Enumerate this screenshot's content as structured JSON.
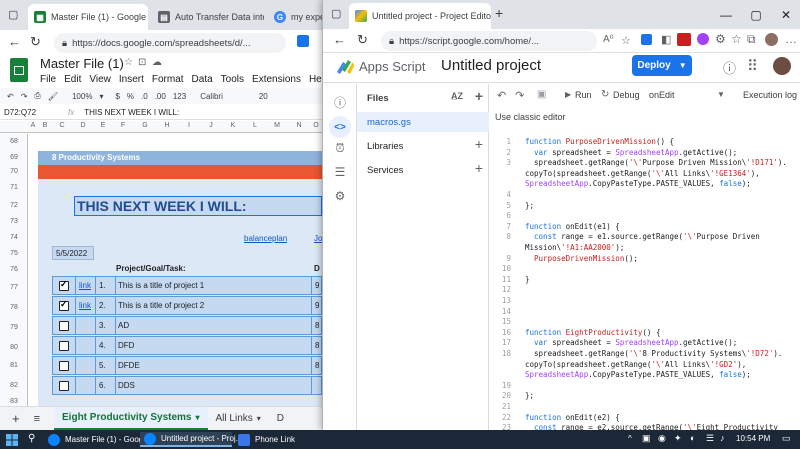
{
  "sheets_window": {
    "tabs": [
      {
        "label": "Master File (1) - Google S",
        "active": true
      },
      {
        "label": "Auto Transfer Data into An",
        "active": false
      },
      {
        "label": "my expert",
        "active": false
      }
    ],
    "url": "https://docs.google.com/spreadsheets/d/...",
    "doc_title": "Master File (1)",
    "menu": [
      "File",
      "Edit",
      "View",
      "Insert",
      "Format",
      "Data",
      "Tools",
      "Extensions",
      "Help",
      "La"
    ],
    "toolbar": {
      "zoom": "100%",
      "currency": "$",
      "percent": "%",
      "dec0": ".0",
      "dec00": ".00",
      "numfmt": "123",
      "font": "Calibri",
      "font_size": "20"
    },
    "formula_bar": {
      "name_box": "D72:Q72",
      "fx": "fx",
      "content": "THIS NEXT WEEK I WILL:"
    },
    "columns": [
      "A",
      "B",
      "C",
      "D",
      "E",
      "F",
      "G",
      "H",
      "I",
      "J",
      "K",
      "L",
      "M",
      "N",
      "O"
    ],
    "rows": [
      "68",
      "69",
      "70",
      "71",
      "72",
      "73",
      "74",
      "75",
      "76",
      "77",
      "78",
      "79",
      "80",
      "81",
      "82",
      "83"
    ],
    "section_title": "8 Productivity Systems",
    "week_header": "THIS NEXT WEEK I WILL:",
    "link_balanceplan": "balanceplan",
    "link_partial": "Jo",
    "date": "5/5/2022",
    "col_header_task": "Project/Goal/Task:",
    "col_header_d": "D",
    "tasks": [
      {
        "checked": true,
        "link": "link",
        "num": "1.",
        "title": "This is a title of project 1",
        "extra": "9"
      },
      {
        "checked": true,
        "link": "link",
        "num": "2.",
        "title": "This is a title of project 2",
        "extra": "9"
      },
      {
        "checked": false,
        "link": "",
        "num": "3.",
        "title": "AD",
        "extra": "8"
      },
      {
        "checked": false,
        "link": "",
        "num": "4.",
        "title": "DFD",
        "extra": "8"
      },
      {
        "checked": false,
        "link": "",
        "num": "5.",
        "title": "DFDE",
        "extra": "8"
      },
      {
        "checked": false,
        "link": "",
        "num": "6.",
        "title": "DDS",
        "extra": ""
      }
    ],
    "sheet_tabs": [
      {
        "label": "Eight Productivity Systems",
        "active": true
      },
      {
        "label": "All Links",
        "active": false
      },
      {
        "label": "D",
        "active": false
      }
    ],
    "add_sheet": "+",
    "all_sheets": "≡"
  },
  "script_window": {
    "tab_label": "Untitled project - Project Editor",
    "url": "https://script.google.com/home/...",
    "brand": "Apps Script",
    "project_title": "Untitled project",
    "deploy_label": "Deploy",
    "files_heading": "Files",
    "file_name": "macros.gs",
    "libraries_label": "Libraries",
    "services_label": "Services",
    "toolbar": {
      "run": "Run",
      "debug": "Debug",
      "function": "onEdit",
      "exec_log": "Execution log"
    },
    "classic_editor": "Use classic editor",
    "code_lines": [
      {
        "n": "1",
        "t": "function PurposeDrivenMission() {"
      },
      {
        "n": "2",
        "t": "  var spreadsheet = SpreadsheetApp.getActive();"
      },
      {
        "n": "3",
        "t": "  spreadsheet.getRange('\\'Purpose Driven Mission\\'!D171')."
      },
      {
        "n": "",
        "t": "copyTo(spreadsheet.getRange('\\'All Links\\'!GE1364'),"
      },
      {
        "n": "",
        "t": "SpreadsheetApp.CopyPasteType.PASTE_VALUES, false);"
      },
      {
        "n": "4",
        "t": ""
      },
      {
        "n": "5",
        "t": "};"
      },
      {
        "n": "6",
        "t": ""
      },
      {
        "n": "7",
        "t": "function onEdit(e1) {"
      },
      {
        "n": "8",
        "t": "  const range = e1.source.getRange('\\'Purpose Driven"
      },
      {
        "n": "",
        "t": "Mission\\'!A1:AA2000');"
      },
      {
        "n": "9",
        "t": "  PurposeDrivenMission();"
      },
      {
        "n": "10",
        "t": ""
      },
      {
        "n": "11",
        "t": "}"
      },
      {
        "n": "12",
        "t": ""
      },
      {
        "n": "13",
        "t": ""
      },
      {
        "n": "14",
        "t": ""
      },
      {
        "n": "15",
        "t": ""
      },
      {
        "n": "16",
        "t": "function EightProductivity() {"
      },
      {
        "n": "17",
        "t": "  var spreadsheet = SpreadsheetApp.getActive();"
      },
      {
        "n": "18",
        "t": "  spreadsheet.getRange('\\'8 Productivity Systems\\'!D72')."
      },
      {
        "n": "",
        "t": "copyTo(spreadsheet.getRange('\\'All Links\\'!GD2'),"
      },
      {
        "n": "",
        "t": "SpreadsheetApp.CopyPasteType.PASTE_VALUES, false);"
      },
      {
        "n": "19",
        "t": ""
      },
      {
        "n": "20",
        "t": "};"
      },
      {
        "n": "21",
        "t": ""
      },
      {
        "n": "22",
        "t": "function onEdit(e2) {"
      },
      {
        "n": "23",
        "t": "  const range = e2.source.getRange('\\'Eight Productivity"
      }
    ]
  },
  "taskbar": {
    "items": [
      {
        "label": "Master File (1) - Goog...",
        "active": false
      },
      {
        "label": "Untitled project - Proj...",
        "active": true
      },
      {
        "label": "Phone Link",
        "active": false
      }
    ],
    "time": "10:54 PM"
  },
  "colors": {
    "accent": "#1a73e8",
    "sheets_green": "#188038",
    "banner_orange": "#e8572f",
    "banner_blue": "#8fb4dc",
    "row_blue": "#c5d9f1",
    "taskbar": "#1b2838"
  }
}
